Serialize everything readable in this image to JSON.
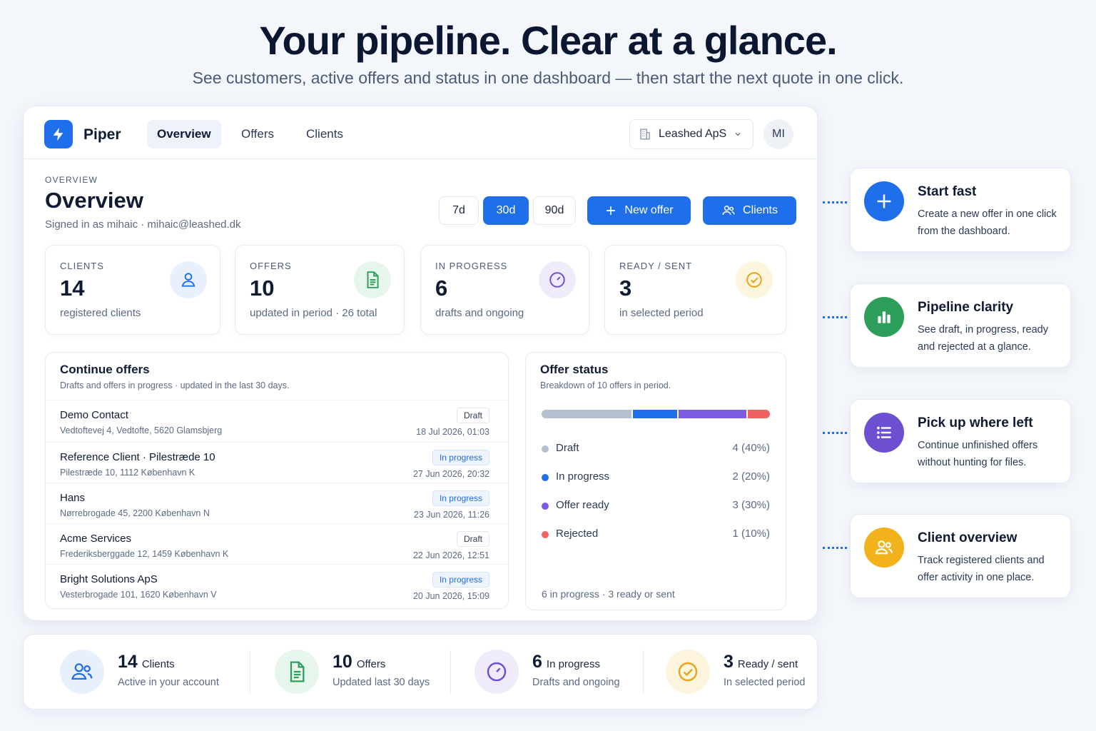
{
  "hero": {
    "title": "Your pipeline. Clear at a glance.",
    "subtitle": "See customers, active offers and status in one dashboard — then start the next quote in one click."
  },
  "app": {
    "brand": "Piper",
    "nav": [
      "Overview",
      "Offers",
      "Clients"
    ],
    "org": "Leashed ApS",
    "avatar": "MI"
  },
  "header": {
    "eyebrow": "OVERVIEW",
    "title": "Overview",
    "signed_in": "Signed in as mihaic · mihaic@leashed.dk",
    "periods": [
      "7d",
      "30d",
      "90d"
    ],
    "active_period": "30d",
    "new_offer": "New offer",
    "clients": "Clients"
  },
  "stats": [
    {
      "label": "CLIENTS",
      "value": "14",
      "sub": "registered clients",
      "icon": "user-icon",
      "color": "#1f6feb"
    },
    {
      "label": "OFFERS",
      "value": "10",
      "sub": "updated in period · 26 total",
      "icon": "document-icon",
      "color": "#2e9e5b"
    },
    {
      "label": "IN PROGRESS",
      "value": "6",
      "sub": "drafts and ongoing",
      "icon": "timer-icon",
      "color": "#6d4fd1"
    },
    {
      "label": "READY / SENT",
      "value": "3",
      "sub": "in selected period",
      "icon": "check-circle-icon",
      "color": "#e8a317"
    }
  ],
  "continue": {
    "title": "Continue offers",
    "subtitle": "Drafts and offers in progress · updated in the last 30 days.",
    "rows": [
      {
        "name": "Demo Contact",
        "address": "Vedtoftevej 4, Vedtofte, 5620 Glamsbjerg",
        "status": "Draft",
        "date": "18 Jul 2026, 01:03"
      },
      {
        "name": "Reference Client · Pilestræde 10",
        "address": "Pilestræde 10, 1112 København K",
        "status": "In progress",
        "date": "27 Jun 2026, 20:32"
      },
      {
        "name": "Hans",
        "address": "Nørrebrogade 45, 2200 København N",
        "status": "In progress",
        "date": "23 Jun 2026, 11:26"
      },
      {
        "name": "Acme Services",
        "address": "Frederiksberggade 12, 1459 København K",
        "status": "Draft",
        "date": "22 Jun 2026, 12:51"
      },
      {
        "name": "Bright Solutions ApS",
        "address": "Vesterbrogade 101, 1620 København V",
        "status": "In progress",
        "date": "20 Jun 2026, 15:09"
      }
    ]
  },
  "status": {
    "title": "Offer status",
    "subtitle": "Breakdown of 10 offers in period.",
    "items": [
      {
        "label": "Draft",
        "value": "4 (40%)",
        "share": 0.4,
        "color": "#b4bfcf"
      },
      {
        "label": "In progress",
        "value": "2 (20%)",
        "share": 0.2,
        "color": "#1f6feb"
      },
      {
        "label": "Offer ready",
        "value": "3 (30%)",
        "share": 0.3,
        "color": "#7c5ce0"
      },
      {
        "label": "Rejected",
        "value": "1 (10%)",
        "share": 0.1,
        "color": "#f06262"
      }
    ],
    "footer": "6 in progress · 3 ready or sent"
  },
  "features": [
    {
      "title": "Start fast",
      "desc": "Create a new offer in one click from the dashboard.",
      "icon": "plus-icon",
      "color": "#1f6feb"
    },
    {
      "title": "Pipeline clarity",
      "desc": "See draft, in progress, ready and rejected at a glance.",
      "icon": "bar-chart-icon",
      "color": "#2e9e5b"
    },
    {
      "title": "Pick up where left",
      "desc": "Continue unfinished offers without hunting for files.",
      "icon": "list-icon",
      "color": "#6d4fd1"
    },
    {
      "title": "Client overview",
      "desc": "Track registered clients and offer activity in one place.",
      "icon": "users-icon",
      "color": "#f2b21b"
    }
  ],
  "summary": [
    {
      "value": "14",
      "label": "Clients",
      "sub": "Active in your account",
      "icon": "users-icon",
      "color": "#1f6feb"
    },
    {
      "value": "10",
      "label": "Offers",
      "sub": "Updated last 30 days",
      "icon": "document-icon",
      "color": "#2e9e5b"
    },
    {
      "value": "6",
      "label": "In progress",
      "sub": "Drafts and ongoing",
      "icon": "timer-icon",
      "color": "#6d4fd1"
    },
    {
      "value": "3",
      "label": "Ready / sent",
      "sub": "In selected period",
      "icon": "check-circle-icon",
      "color": "#e8a317"
    }
  ]
}
